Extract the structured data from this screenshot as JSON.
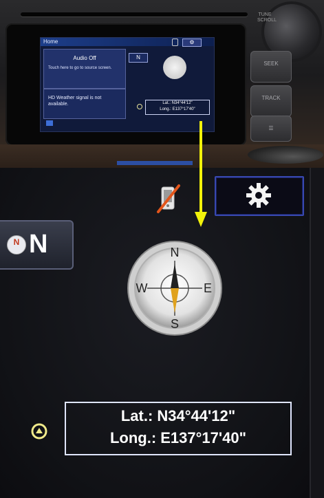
{
  "head_unit": {
    "home_title": "Home",
    "audio_status": "Audio Off",
    "audio_hint": "Touch here to go to source screen.",
    "hd_weather_message": "HD Weather signal is not available.",
    "heading_badge": "N",
    "lat_small": "Lat.: N34°44'12\"",
    "long_small": "Long.: E137°17'40\"",
    "knob_label": "TUNE SCROLL",
    "buttons": [
      "SEEK",
      "TRACK",
      "☰"
    ]
  },
  "screen": {
    "heading_letter": "N",
    "heading_icon_letter": "N",
    "compass_labels": {
      "n": "N",
      "s": "S",
      "e": "E",
      "w": "W"
    },
    "latitude": "Lat.: N34°44'12\"",
    "longitude": "Long.: E137°17'40\""
  },
  "colors": {
    "accent_blue": "#3848b0",
    "arrow_yellow": "#f2f20a",
    "phone_strike": "#e2551b"
  },
  "icons": {
    "phone": "phone-off-icon",
    "settings": "gear-icon",
    "compass": "compass-icon",
    "coordinate": "location-icon"
  }
}
